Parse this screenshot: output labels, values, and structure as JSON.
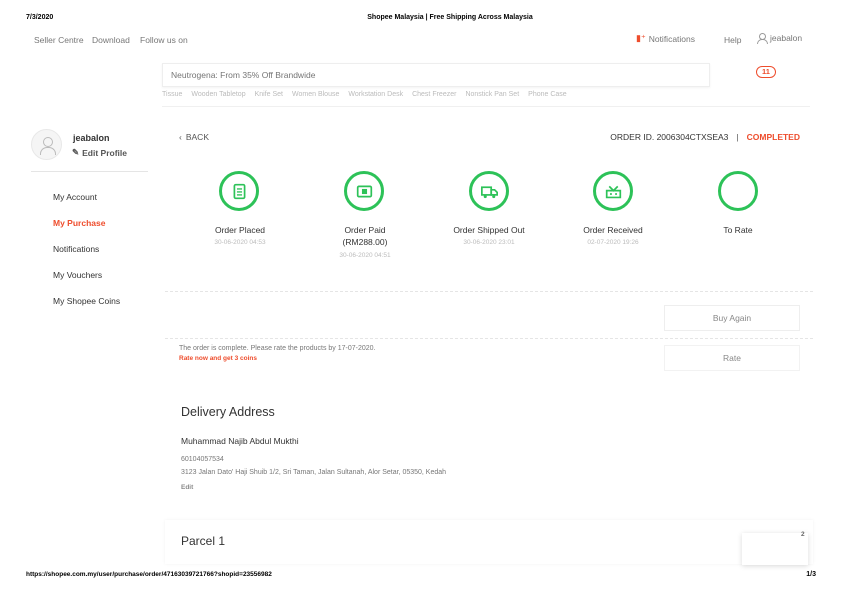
{
  "print": {
    "date": "7/3/2020",
    "title": "Shopee Malaysia | Free Shipping Across Malaysia",
    "url": "https://shopee.com.my/user/purchase/order/47163039721766?shopid=23556982",
    "page": "1/3"
  },
  "topnav": {
    "seller_centre": "Seller Centre",
    "download": "Download",
    "follow_us": "Follow us on",
    "notifications": "Notifications",
    "help": "Help",
    "username": "jeabalon"
  },
  "search": {
    "placeholder": "Neutrogena: From 35% Off Brandwide",
    "cart_count": "11",
    "suggestions": [
      "Tissue",
      "Wooden Tabletop",
      "Knife Set",
      "Women Blouse",
      "Workstation Desk",
      "Chest Freezer",
      "Nonstick Pan Set",
      "Phone Case"
    ]
  },
  "sidebar": {
    "username": "jeabalon",
    "edit_profile": "Edit Profile",
    "items": [
      {
        "label": "My Account"
      },
      {
        "label": "My Purchase"
      },
      {
        "label": "Notifications"
      },
      {
        "label": "My Vouchers"
      },
      {
        "label": "My Shopee Coins"
      }
    ]
  },
  "order": {
    "back": "BACK",
    "id_label": "ORDER ID. 2006304CTXSEA3",
    "separator": "|",
    "status": "COMPLETED",
    "steps": [
      {
        "label": "Order Placed",
        "sub": "",
        "time": "30-06-2020 04:53",
        "icon": "receipt-icon"
      },
      {
        "label": "Order Paid",
        "sub": "(RM288.00)",
        "time": "30-06-2020 04:51",
        "icon": "payment-icon"
      },
      {
        "label": "Order Shipped Out",
        "sub": "",
        "time": "30-06-2020 23:01",
        "icon": "truck-icon"
      },
      {
        "label": "Order Received",
        "sub": "",
        "time": "02-07-2020 19:26",
        "icon": "inbox-icon"
      },
      {
        "label": "To Rate",
        "sub": "",
        "time": "",
        "icon": "star-icon"
      }
    ],
    "buy_again": "Buy Again",
    "complete_note": "The order is complete. Please rate the products by 17-07-2020.",
    "rate_note": "Rate now and get 3 coins",
    "rate_btn": "Rate"
  },
  "delivery": {
    "title": "Delivery Address",
    "name": "Muhammad Najib Abdul Mukthi",
    "phone": "60104057534",
    "address": "3123 Jalan Dato' Haji Shuib 1/2, Sri Taman, Jalan Sultanah, Alor Setar, 05350, Kedah",
    "edit": "Edit"
  },
  "parcel": {
    "title": "Parcel 1",
    "badge": "2"
  },
  "colors": {
    "brand": "#ee4d2d",
    "success": "#2dc258"
  }
}
